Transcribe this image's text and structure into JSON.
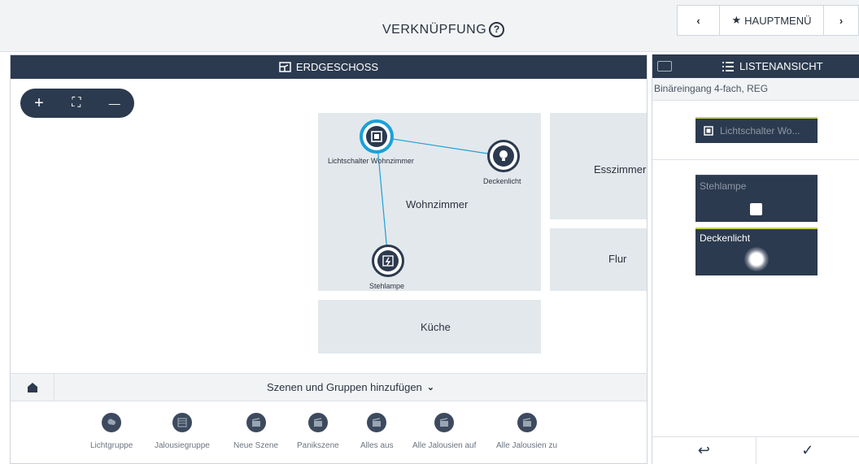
{
  "header": {
    "title": "VERKNÜPFUNG",
    "help_icon": "?",
    "nav_back": "‹",
    "nav_main_label": "HAUPTMENÜ",
    "nav_forward": "›"
  },
  "floorplan": {
    "title": "ERDGESCHOSS",
    "zoom": {
      "in": "+",
      "fit": "⛶",
      "out": "—"
    },
    "rooms": [
      {
        "name": "Wohnzimmer"
      },
      {
        "name": "Esszimmer"
      },
      {
        "name": "Flur"
      },
      {
        "name": "Küche"
      }
    ],
    "devices": [
      {
        "label": "Lichtschalter Wohnzimmer",
        "icon": "switch-icon"
      },
      {
        "label": "Deckenlicht",
        "icon": "bulb-icon"
      },
      {
        "label": "Stehlampe",
        "icon": "socket-icon"
      }
    ]
  },
  "scenes_bar": {
    "label": "Szenen und Gruppen hinzufügen"
  },
  "scene_tray": [
    {
      "label": "Lichtgruppe",
      "icon": "light-group-icon"
    },
    {
      "label": "Jalousiegruppe",
      "icon": "blind-group-icon"
    },
    {
      "label": "Neue Szene",
      "icon": "scene-icon"
    },
    {
      "label": "Panikszene",
      "icon": "panic-scene-icon"
    },
    {
      "label": "Alles aus",
      "icon": "all-off-icon"
    },
    {
      "label": "Alle Jalousien auf",
      "icon": "blinds-up-icon"
    },
    {
      "label": "Alle Jalousien zu",
      "icon": "blinds-down-icon"
    }
  ],
  "list_panel": {
    "title": "LISTENANSICHT",
    "device_name": "Binäreingang 4-fach, REG",
    "source_tile": {
      "label": "Lichtschalter Wo..."
    },
    "targets": [
      {
        "label": "Stehlampe"
      },
      {
        "label": "Deckenlicht"
      }
    ],
    "footer": {
      "back": "↩",
      "confirm": "✓"
    }
  },
  "colors": {
    "dark_navy": "#2c3a4f",
    "accent_blue": "#1aa0d8",
    "room_grey": "#e3e8ec",
    "tile_accent": "#c8d44b"
  }
}
